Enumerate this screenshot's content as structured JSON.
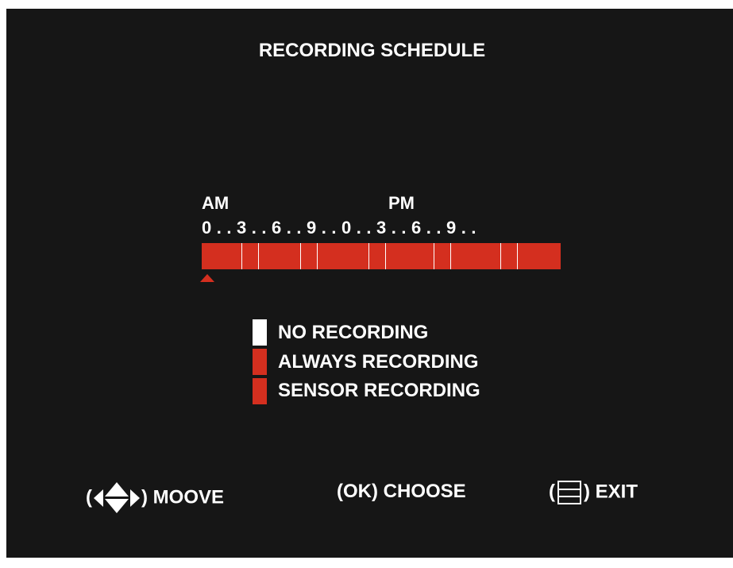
{
  "title": "RECORDING SCHEDULE",
  "timeline": {
    "am_label": "AM",
    "pm_label": "PM",
    "ticks": "0 . . 3 . . 6 . . 9 . . 0 . . 3 . . 6 . . 9 . .",
    "hour_segments": 24,
    "selected_hour": 0
  },
  "legend": [
    {
      "label": "NO RECORDING",
      "color": "#ffffff"
    },
    {
      "label": "ALWAYS RECORDING",
      "color": "#d42f1f"
    },
    {
      "label": "SENSOR RECORDING",
      "color": "#d42f1f"
    }
  ],
  "footer": {
    "move_open": "(",
    "move_close": ") MOOVE",
    "choose": "(OK) CHOOSE",
    "exit_open": "(",
    "exit_close": ") EXIT"
  },
  "colors": {
    "background": "#161616",
    "accent": "#d42f1f",
    "text": "#ffffff"
  },
  "icons": [
    "left-arrow-icon",
    "up-down-arrow-icon",
    "right-arrow-icon",
    "menu-icon"
  ]
}
